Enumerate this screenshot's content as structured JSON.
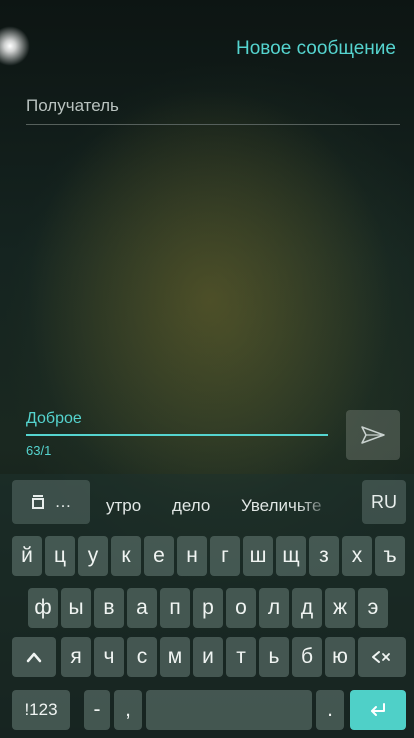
{
  "header": {
    "title": "Новое сообщение"
  },
  "recipient": {
    "placeholder": "Получатель"
  },
  "message": {
    "text": "Доброе",
    "counter": "63/1"
  },
  "suggestions": {
    "clipboard": "…",
    "items": [
      "утро",
      "дело",
      "Увеличьте"
    ],
    "language": "RU"
  },
  "keyboard": {
    "row1": [
      "й",
      "ц",
      "у",
      "к",
      "е",
      "н",
      "г",
      "ш",
      "щ",
      "з",
      "х",
      "ъ"
    ],
    "row2": [
      "ф",
      "ы",
      "в",
      "а",
      "п",
      "р",
      "о",
      "л",
      "д",
      "ж",
      "э"
    ],
    "row3": [
      "я",
      "ч",
      "с",
      "м",
      "и",
      "т",
      "ь",
      "б",
      "ю"
    ],
    "shift_glyph": "^",
    "backspace_glyph": "<×",
    "numbers_label": "!123",
    "dash_key": "-",
    "comma_key": ",",
    "period_key": "."
  },
  "colors": {
    "accent": "#55d4cf",
    "enter": "#4fd0c8"
  }
}
